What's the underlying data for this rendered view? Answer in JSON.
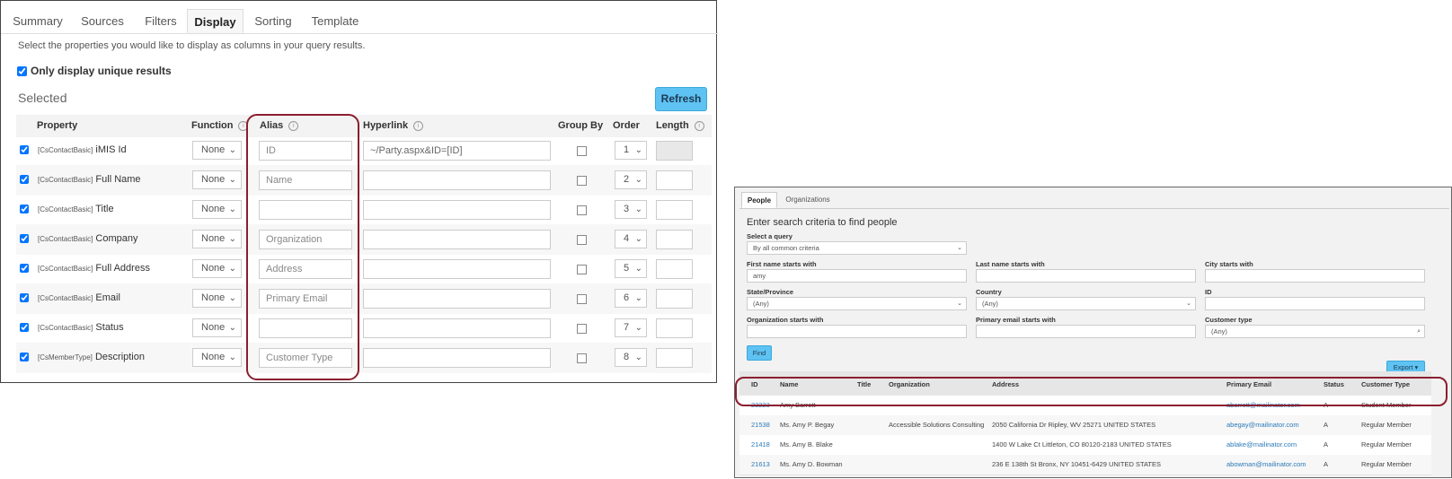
{
  "display": {
    "tabs": [
      "Summary",
      "Sources",
      "Filters",
      "Display",
      "Sorting",
      "Template"
    ],
    "intro": "Select the properties you would like to display as columns in your query results.",
    "unique_label": "Only display unique results",
    "selected_title": "Selected",
    "refresh_label": "Refresh",
    "columns": {
      "property": "Property",
      "function": "Function",
      "alias": "Alias",
      "hyperlink": "Hyperlink",
      "group_by": "Group By",
      "order": "Order",
      "length": "Length"
    },
    "rows": [
      {
        "source": "[CsContactBasic]",
        "name": "iMIS Id",
        "function": "None",
        "alias": "ID",
        "hyperlink": "~/Party.aspx&ID=[ID]",
        "order": "1"
      },
      {
        "source": "[CsContactBasic]",
        "name": "Full Name",
        "function": "None",
        "alias": "Name",
        "hyperlink": "",
        "order": "2"
      },
      {
        "source": "[CsContactBasic]",
        "name": "Title",
        "function": "None",
        "alias": "",
        "hyperlink": "",
        "order": "3"
      },
      {
        "source": "[CsContactBasic]",
        "name": "Company",
        "function": "None",
        "alias": "Organization",
        "hyperlink": "",
        "order": "4"
      },
      {
        "source": "[CsContactBasic]",
        "name": "Full Address",
        "function": "None",
        "alias": "Address",
        "hyperlink": "",
        "order": "5"
      },
      {
        "source": "[CsContactBasic]",
        "name": "Email",
        "function": "None",
        "alias": "Primary Email",
        "hyperlink": "",
        "order": "6"
      },
      {
        "source": "[CsContactBasic]",
        "name": "Status",
        "function": "None",
        "alias": "",
        "hyperlink": "",
        "order": "7"
      },
      {
        "source": "[CsMemberType]",
        "name": "Description",
        "function": "None",
        "alias": "Customer Type",
        "hyperlink": "",
        "order": "8"
      }
    ],
    "highlight_color": "#8b1e2e",
    "accent_color": "#5ec3f2"
  },
  "search": {
    "tabs": [
      "People",
      "Organizations"
    ],
    "heading": "Enter search criteria to find people",
    "fields": {
      "query_label": "Select a query",
      "query_value": "By all common criteria",
      "first_label": "First name starts with",
      "first_value": "amy",
      "last_label": "Last name starts with",
      "city_label": "City starts with",
      "state_label": "State/Province",
      "state_value": "(Any)",
      "country_label": "Country",
      "country_value": "(Any)",
      "id_label": "ID",
      "org_label": "Organization starts with",
      "email_label": "Primary email starts with",
      "ctype_label": "Customer type",
      "ctype_value": "(Any)"
    },
    "find_label": "Find",
    "export_label": "Export ▾",
    "columns": [
      "ID",
      "Name",
      "Title",
      "Organization",
      "Address",
      "Primary Email",
      "Status",
      "Customer Type"
    ],
    "rows": [
      {
        "id": "23223",
        "name": "Amy Barrett",
        "title": "",
        "org": "",
        "address": "",
        "email": "abarrett@mailinator.com",
        "status": "A",
        "type": "Student Member"
      },
      {
        "id": "21538",
        "name": "Ms. Amy P. Begay",
        "title": "",
        "org": "Accessible Solutions Consulting",
        "address": "2050 California Dr Ripley, WV 25271 UNITED STATES",
        "email": "abegay@mailinator.com",
        "status": "A",
        "type": "Regular Member"
      },
      {
        "id": "21418",
        "name": "Ms. Amy B. Blake",
        "title": "",
        "org": "",
        "address": "1400 W Lake Ct Littleton, CO 80120-2183 UNITED STATES",
        "email": "ablake@mailinator.com",
        "status": "A",
        "type": "Regular Member"
      },
      {
        "id": "21613",
        "name": "Ms. Amy D. Bowman",
        "title": "",
        "org": "",
        "address": "236 E 138th St Bronx, NY 10451-6429 UNITED STATES",
        "email": "abowman@mailinator.com",
        "status": "A",
        "type": "Regular Member"
      }
    ]
  }
}
